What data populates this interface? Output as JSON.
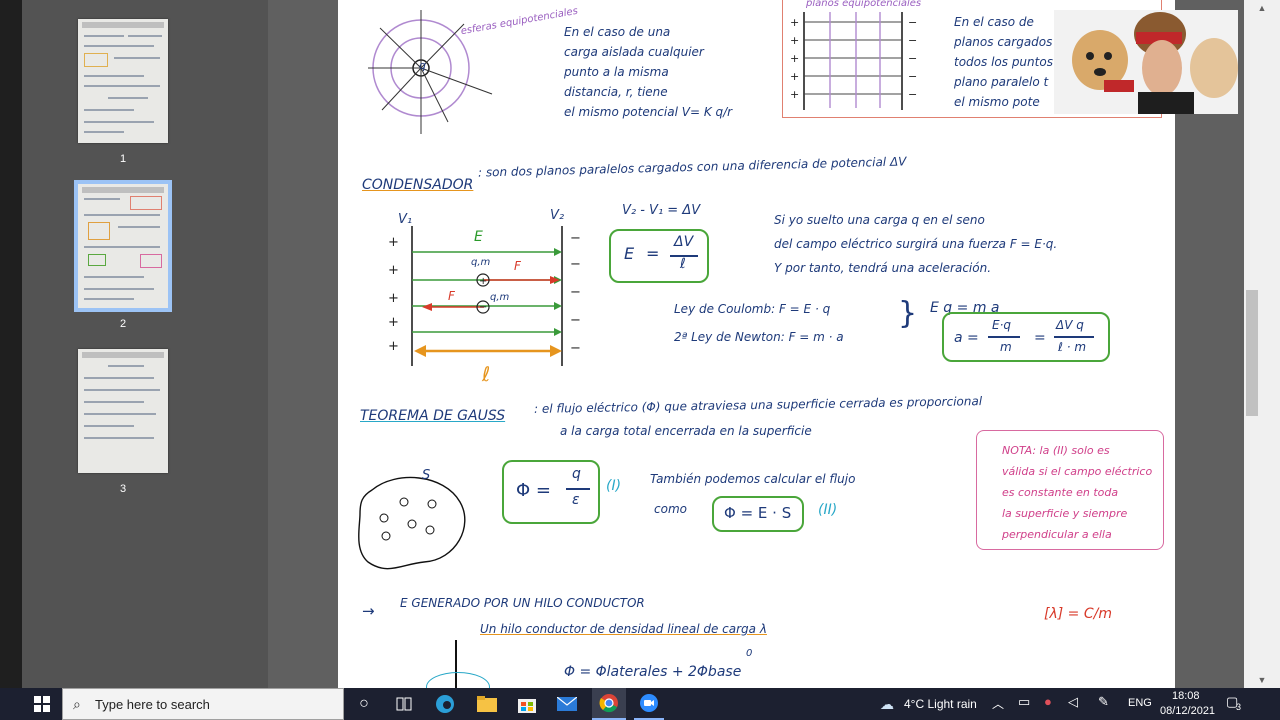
{
  "thumbnails": {
    "pages": [
      {
        "number": "1"
      },
      {
        "number": "2",
        "selected": true
      },
      {
        "number": "3"
      }
    ]
  },
  "notes": {
    "sphere": {
      "label": "esferas equipotenciales",
      "charge": "q",
      "text_lines": [
        "En el caso de una",
        "carga aislada cualquier",
        "punto a la misma",
        "distancia, r, tiene",
        "el mismo potencial V= K q/r"
      ]
    },
    "planes": {
      "label": "planos equipotenciales",
      "text_lines": [
        "En el caso de",
        "planos cargados",
        "todos los puntos de",
        "plano paralelo t",
        "el mismo pote"
      ]
    },
    "condensador": {
      "title": "CONDENSADOR",
      "definition": ": son dos planos paralelos cargados con una diferencia de potencial ΔV",
      "v1": "V₁",
      "v2": "V₂",
      "field_label": "E",
      "qm1": "q,m",
      "qm2": "q,m",
      "force_label": "F",
      "length_label": "ℓ",
      "potential_diff": "V₂ - V₁ = ΔV",
      "field_formula_e": "E",
      "field_formula_num": "ΔV",
      "field_formula_den": "ℓ",
      "explanation": [
        "Si yo suelto una carga q en el seno",
        "del campo eléctrico surgirá una fuerza F = E·q.",
        "Y por tanto, tendrá una aceleración."
      ],
      "coulomb": "Ley de Coulomb:   F = E · q",
      "newton": "2ª Ley de Newton:   F = m · a",
      "eq_result": "E q = m a",
      "accel_a": "a =",
      "accel_num1": "E·q",
      "accel_den1": "m",
      "accel_eq": "=",
      "accel_num2": "ΔV q",
      "accel_den2": "ℓ · m"
    },
    "gauss": {
      "title": "TEOREMA DE GAUSS",
      "definition_1": ": el flujo eléctrico (Φ) que atraviesa una superficie cerrada es proporcional",
      "definition_2": "a la carga total encerrada en la superficie",
      "surface_label": "S",
      "flux_phi": "Φ =",
      "flux_num": "q",
      "flux_den": "ε",
      "ref_1": "(I)",
      "also_1": "También podemos calcular el flujo",
      "also_2": "como",
      "flux_es": "Φ = E · S",
      "ref_2": "(II)",
      "note_lines": [
        "NOTA: la (II) solo es",
        "válida si el campo eléctrico",
        "es constante en toda",
        "la superficie y siempre",
        "perpendicular a ella"
      ]
    },
    "hilo": {
      "arrow": "→",
      "title": "E GENERADO POR UN HILO CONDUCTOR",
      "subtitle": "Un hilo conductor de densidad lineal de carga λ",
      "units": "[λ] = C/m",
      "flux": "Φ = Φlaterales + 2Φbase",
      "zero": "0"
    }
  },
  "taskbar": {
    "search_placeholder": "Type here to search",
    "weather": "4°C  Light rain",
    "language": "ENG",
    "time": "18:08",
    "date": "08/12/2021",
    "notifications": "3"
  }
}
